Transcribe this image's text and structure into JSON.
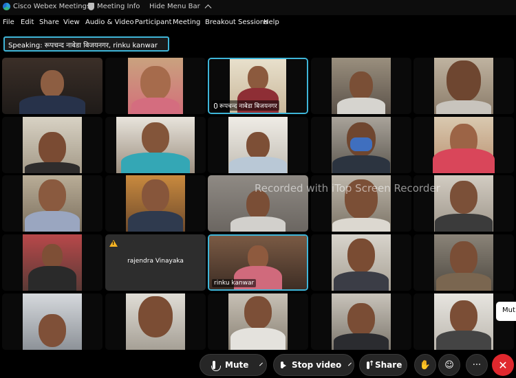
{
  "window": {
    "app_title": "Cisco Webex Meetings",
    "meeting_info": "Meeting Info",
    "hide_menu_bar": "Hide Menu Bar"
  },
  "menu": {
    "file": "File",
    "edit": "Edit",
    "share": "Share",
    "view": "View",
    "audio_video": "Audio & Video",
    "participant": "Participant",
    "meeting": "Meeting",
    "breakout": "Breakout Sessions",
    "help": "Help"
  },
  "speaking": "Speaking: रूपचन्द नाबेडा बिजयनगर, rinku kanwar",
  "tiles": {
    "r1c3_name": "रूपचन्द नाबेडा बिजयनगर",
    "r4c2_name": "rajendra Vinayaka",
    "r4c3_name": "rinku kanwar"
  },
  "watermark": "Recorded with iTop Screen Recorder",
  "side_chip": "Mut",
  "controls": {
    "mute": "Mute",
    "stop_video": "Stop video",
    "share": "Share",
    "raise_hand_icon": "hand-icon",
    "reactions_icon": "smile-icon",
    "more": "···",
    "end": "✕"
  },
  "colors": {
    "active_border": "#3fb6d9",
    "end_button": "#e0282e",
    "warning": "#f5b324"
  }
}
